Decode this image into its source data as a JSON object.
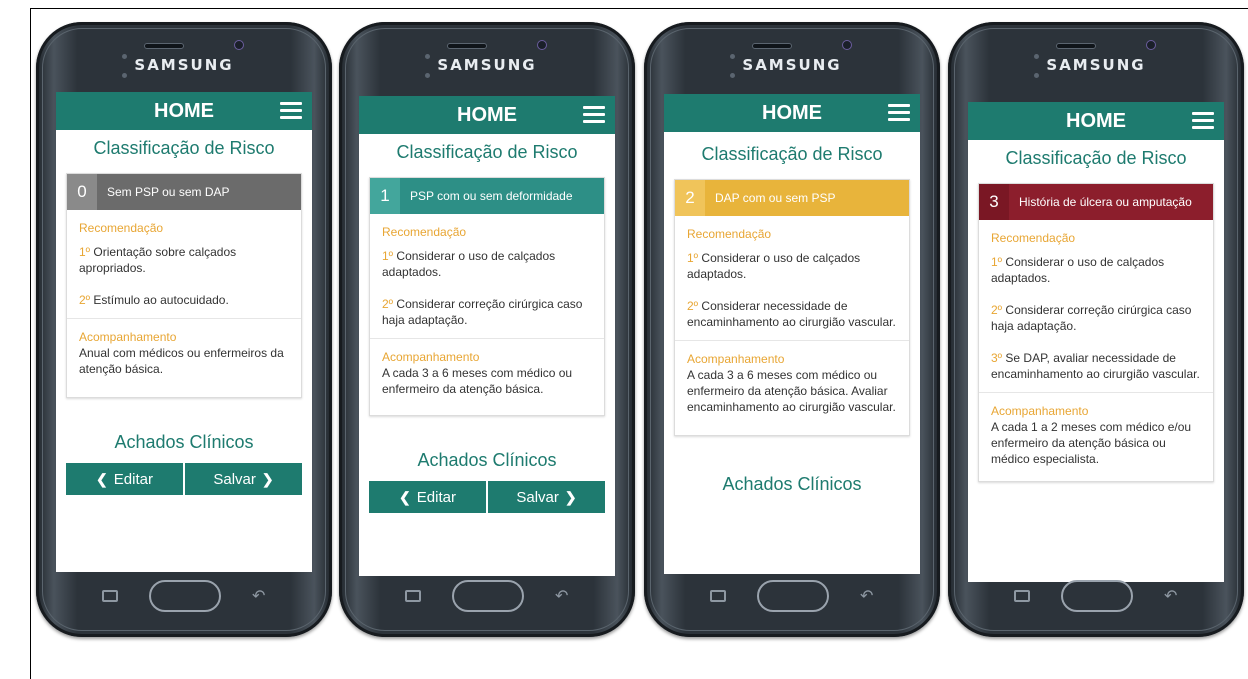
{
  "phones": [
    {
      "brand": "SAMSUNG",
      "app_title": "HOME",
      "page_title": "Classificação de Risco",
      "level": "0",
      "level_label": "Sem PSP ou sem DAP",
      "level_color": "#6b6b6b",
      "level_num_color": "#8a8a8a",
      "rec_title": "Recomendação",
      "items": [
        {
          "ord": "1º",
          "text": " Orientação sobre calçados apropriados."
        },
        {
          "ord": "2º",
          "text": " Estímulo ao autocuidado."
        }
      ],
      "follow_title": "Acompanhamento",
      "follow_text": "Anual com médicos ou enfermeiros da atenção básica.",
      "achados": "Achados Clínicos",
      "edit_label": "Editar",
      "save_label": "Salvar"
    },
    {
      "brand": "SAMSUNG",
      "app_title": "HOME",
      "page_title": "Classificação de Risco",
      "level": "1",
      "level_label": "PSP com ou sem deformidade",
      "level_color": "#2d8f86",
      "level_num_color": "#43a69c",
      "rec_title": "Recomendação",
      "items": [
        {
          "ord": "1º",
          "text": " Considerar o uso de calçados adaptados."
        },
        {
          "ord": "2º",
          "text": " Considerar correção cirúrgica caso haja adaptação."
        }
      ],
      "follow_title": "Acompanhamento",
      "follow_text": "A cada 3 a 6 meses com médico ou enfermeiro da atenção básica.",
      "achados": "Achados Clínicos",
      "edit_label": "Editar",
      "save_label": "Salvar"
    },
    {
      "brand": "SAMSUNG",
      "app_title": "HOME",
      "page_title": "Classificação de Risco",
      "level": "2",
      "level_label": "DAP com ou sem PSP",
      "level_color": "#e8b43b",
      "level_num_color": "#f0c45a",
      "rec_title": "Recomendação",
      "items": [
        {
          "ord": "1º",
          "text": " Considerar o uso de calçados adaptados."
        },
        {
          "ord": "2º",
          "text": " Considerar necessidade de encaminhamento ao cirurgião vascular."
        }
      ],
      "follow_title": "Acompanhamento",
      "follow_text": "A cada 3 a 6 meses com médico ou enfermeiro da atenção básica. Avaliar encaminhamento ao cirurgião vascular.",
      "achados": "Achados Clínicos"
    },
    {
      "brand": "SAMSUNG",
      "app_title": "HOME",
      "page_title": "Classificação de Risco",
      "level": "3",
      "level_label": "História de úlcera ou amputação",
      "level_color": "#8c1e2c",
      "level_num_color": "#7a1724",
      "rec_title": "Recomendação",
      "items": [
        {
          "ord": "1º",
          "text": " Considerar o uso de calçados adaptados."
        },
        {
          "ord": "2º",
          "text": " Considerar correção cirúrgica caso haja adaptação."
        },
        {
          "ord": "3º",
          "text": " Se DAP, avaliar necessidade de encaminhamento ao cirurgião vascular."
        }
      ],
      "follow_title": "Acompanhamento",
      "follow_text": "A cada 1 a 2 meses com médico e/ou enfermeiro da atenção básica ou médico especialista."
    }
  ]
}
